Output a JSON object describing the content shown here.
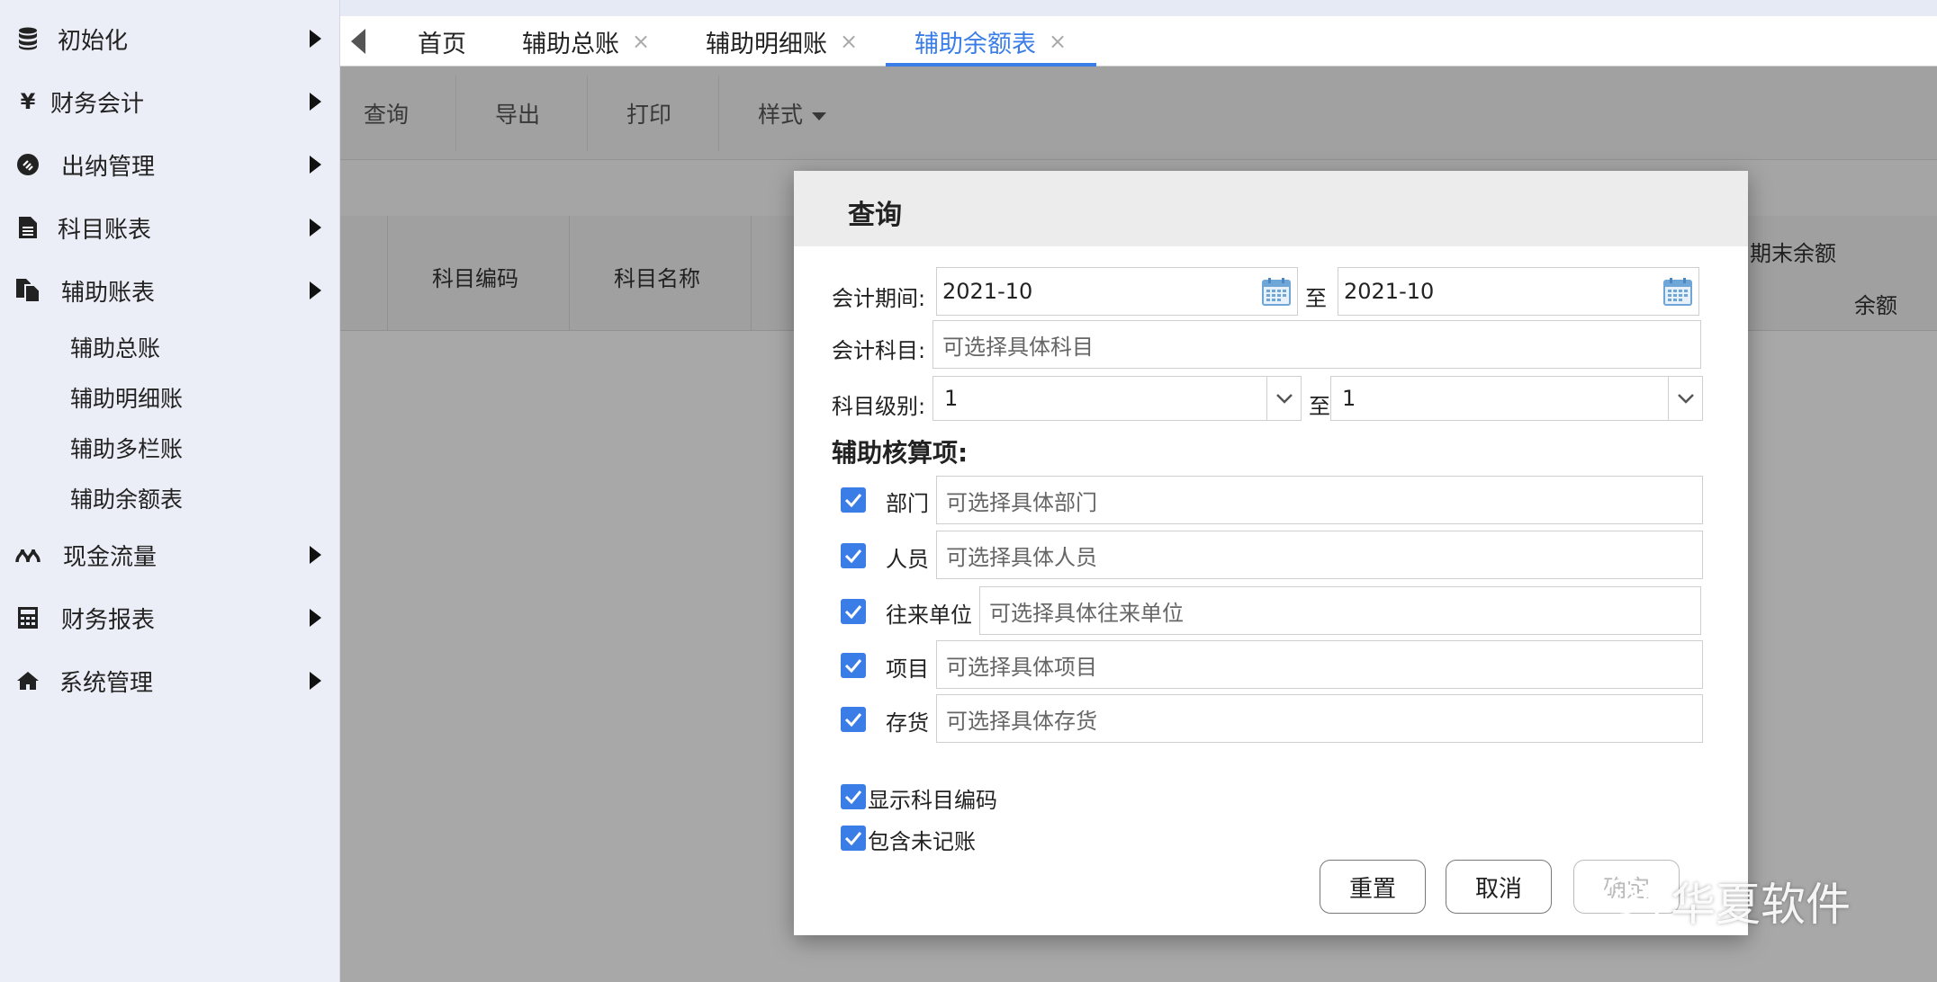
{
  "sidebar": {
    "items": [
      {
        "label": "初始化",
        "icon": "database-icon"
      },
      {
        "label": "财务会计",
        "icon": "yen-icon"
      },
      {
        "label": "出纳管理",
        "icon": "cashier-icon"
      },
      {
        "label": "科目账表",
        "icon": "document-icon"
      },
      {
        "label": "辅助账表",
        "icon": "copy-document-icon"
      },
      {
        "label": "现金流量",
        "icon": "cashflow-icon"
      },
      {
        "label": "财务报表",
        "icon": "calculator-icon"
      },
      {
        "label": "系统管理",
        "icon": "home-icon"
      }
    ],
    "subitems": [
      "辅助总账",
      "辅助明细账",
      "辅助多栏账",
      "辅助余额表"
    ]
  },
  "tabs": [
    {
      "label": "首页",
      "closable": false
    },
    {
      "label": "辅助总账",
      "closable": true
    },
    {
      "label": "辅助明细账",
      "closable": true
    },
    {
      "label": "辅助余额表",
      "closable": true,
      "active": true
    }
  ],
  "tab_close_glyph": "×",
  "toolbar": {
    "query": "查询",
    "export": "导出",
    "print": "打印",
    "style": "样式"
  },
  "table": {
    "col_code": "科目编码",
    "col_name": "科目名称",
    "col_end_balance": "期末余额",
    "col_balance": "余额"
  },
  "dialog": {
    "title": "查询",
    "period_label": "会计期间:",
    "period_from": "2021-10",
    "period_to": "2021-10",
    "to_label": "至",
    "subject_label": "会计科目:",
    "subject_placeholder": "可选择具体科目",
    "level_label": "科目级别:",
    "level_from": "1",
    "level_to": "1",
    "aux_section": "辅助核算项:",
    "aux_items": [
      {
        "label": "部门",
        "placeholder": "可选择具体部门",
        "checked": true
      },
      {
        "label": "人员",
        "placeholder": "可选择具体人员",
        "checked": true
      },
      {
        "label": "往来单位",
        "placeholder": "可选择具体往来单位",
        "checked": true
      },
      {
        "label": "项目",
        "placeholder": "可选择具体项目",
        "checked": true
      },
      {
        "label": "存货",
        "placeholder": "可选择具体存货",
        "checked": true
      }
    ],
    "show_code_label": "显示科目编码",
    "include_unposted_label": "包含未记账",
    "reset": "重置",
    "cancel": "取消",
    "confirm": "确定"
  },
  "watermark": "华夏软件",
  "colors": {
    "accent": "#3a7de6",
    "sidebar_bg": "#eceef7",
    "mask": "rgba(0,0,0,0.34)"
  }
}
